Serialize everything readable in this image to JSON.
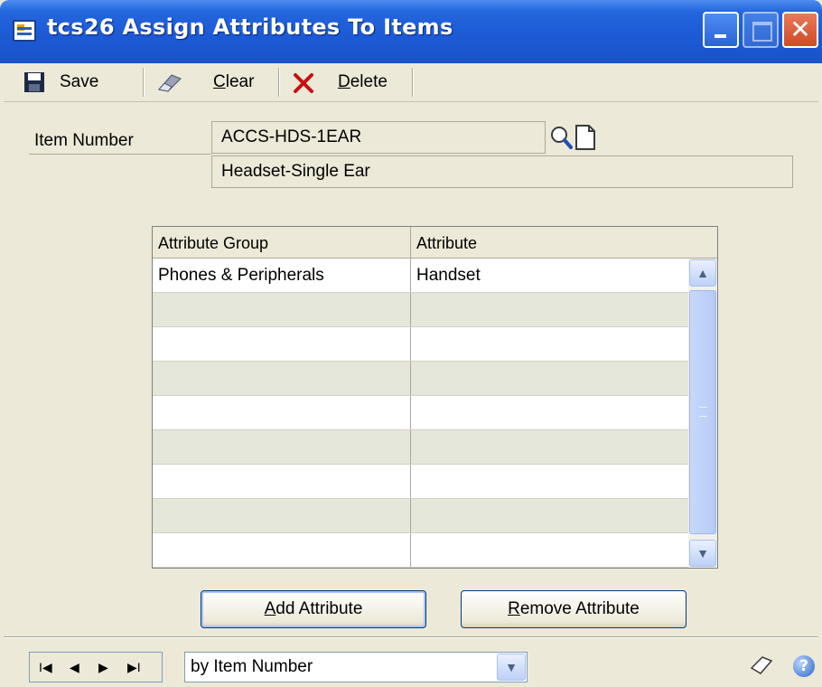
{
  "window": {
    "title": "tcs26 Assign Attributes To Items"
  },
  "toolbar": {
    "save_label": "Save",
    "clear_label_hotkey": "C",
    "clear_label_rest": "lear",
    "delete_label_hotkey": "D",
    "delete_label_rest": "elete"
  },
  "form": {
    "item_number_label": "Item Number",
    "item_number_value": "ACCS-HDS-1EAR",
    "item_description": "Headset-Single Ear"
  },
  "grid": {
    "columns": [
      "Attribute Group",
      "Attribute"
    ],
    "rows": [
      {
        "group": "Phones & Peripherals",
        "attribute": "Handset"
      },
      {
        "group": "",
        "attribute": ""
      },
      {
        "group": "",
        "attribute": ""
      },
      {
        "group": "",
        "attribute": ""
      },
      {
        "group": "",
        "attribute": ""
      },
      {
        "group": "",
        "attribute": ""
      },
      {
        "group": "",
        "attribute": ""
      },
      {
        "group": "",
        "attribute": ""
      },
      {
        "group": "",
        "attribute": ""
      }
    ]
  },
  "buttons": {
    "add_hotkey": "A",
    "add_rest": "dd Attribute",
    "remove_hotkey": "R",
    "remove_rest": "emove Attribute"
  },
  "browse": {
    "nav_first": "I◀",
    "nav_prev": "◀",
    "nav_next": "▶",
    "nav_last": "▶I",
    "sort_value": "by Item Number"
  },
  "icons": {
    "titlebar_close": "✕",
    "help": "?"
  }
}
